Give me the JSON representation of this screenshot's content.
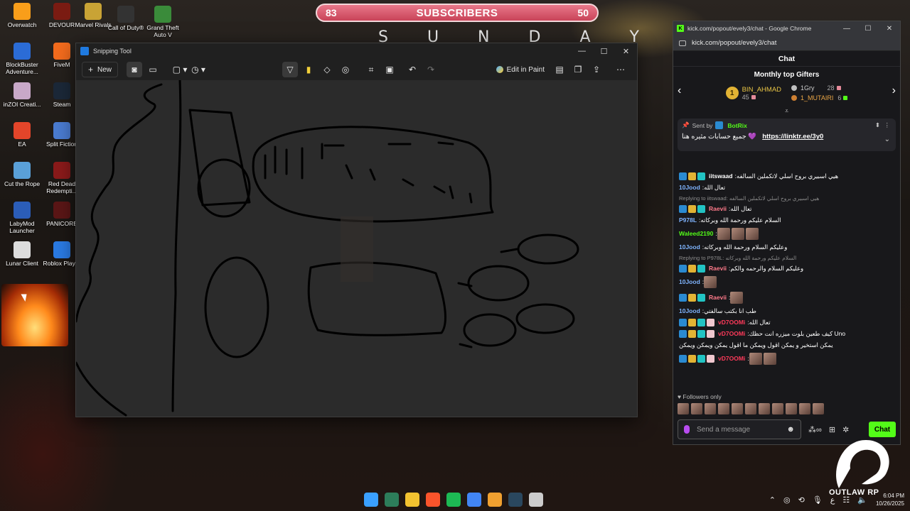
{
  "subscriber_bar": {
    "left_count": "83",
    "label": "SUBSCRIBERS",
    "right_count": "50"
  },
  "banner_text": "S U N D A Y",
  "desktop_icons": [
    {
      "label": "Overwatch",
      "color": "#f99e1a"
    },
    {
      "label": "DEVOUR",
      "color": "#7a1b12"
    },
    {
      "label": "Marvel Rivals",
      "color": "#c9a335"
    },
    {
      "label": "Call of Duty®",
      "color": "#333333"
    },
    {
      "label": "Grand Theft Auto V",
      "color": "#3a8b3a"
    },
    {
      "label": "BlockBuster Adventure...",
      "color": "#2b6cd6"
    },
    {
      "label": "FiveM",
      "color": "#f26b1d"
    },
    {
      "label": "inZOI Creati...",
      "color": "#c8a8c8"
    },
    {
      "label": "Steam",
      "color": "#1b2838"
    },
    {
      "label": "EA",
      "color": "#e3452a"
    },
    {
      "label": "Split Fiction",
      "color": "#4a7bd0"
    },
    {
      "label": "Cut the Rope",
      "color": "#5aa0d8"
    },
    {
      "label": "Red Dead Redempti...",
      "color": "#8a1a1a"
    },
    {
      "label": "LabyMod Launcher",
      "color": "#2b5db8"
    },
    {
      "label": "PANICORE",
      "color": "#5a1616"
    },
    {
      "label": "Lunar Client",
      "color": "#dddddd"
    },
    {
      "label": "Roblox Player",
      "color": "#2a7ae2"
    }
  ],
  "snipping_tool": {
    "title": "Snipping Tool",
    "new_label": "New",
    "edit_in_paint": "Edit in Paint",
    "window_controls": [
      "—",
      "☐",
      "✕"
    ]
  },
  "chat_window": {
    "chrome_title": "kick.com/popout/evely3/chat - Google Chrome",
    "url": "kick.com/popout/evely3/chat",
    "header": "Chat",
    "gifters_title": "Monthly top Gifters",
    "top_gifter": {
      "rank": "1",
      "name": "BIN_AHMAD",
      "count": "45"
    },
    "gifter_2": {
      "name": "1Gry",
      "count": "28"
    },
    "gifter_3": {
      "name": "1_MUTAIRI",
      "count": "6"
    },
    "pinned": {
      "sent_by": "Sent by",
      "bot": "BotRix",
      "message": "جميع حسابات مثيره هنا 💜",
      "link": "https://linktr.ee/3y0"
    },
    "messages": [
      {
        "user": "iitswaad",
        "user_color": "#ffffff",
        "badges": 3,
        "text": "هيي اسبيري بروح اسلي لاتكملين السالفه",
        "reply": ""
      },
      {
        "user": "10Jood",
        "user_color": "#7fb4ff",
        "badges": 0,
        "text": "تعال الله",
        "reply": ""
      },
      {
        "user": "Raevii",
        "user_color": "#ff7a8a",
        "badges": 3,
        "text": "تعال الله",
        "reply": "Replying to iitswaad: هيي اسبيري بروح اسلي لاتكملين السالفه"
      },
      {
        "user": "P978L",
        "user_color": "#7fb4ff",
        "badges": 0,
        "text": "السلام عليكم ورحمة الله وبركاته",
        "reply": ""
      },
      {
        "user": "Waleed2190",
        "user_color": "#53fc18",
        "badges": 0,
        "text": "",
        "emotes": 3,
        "reply": ""
      },
      {
        "user": "10Jood",
        "user_color": "#7fb4ff",
        "badges": 0,
        "text": "وعليكم السلام ورحمة الله وبركاته",
        "reply": ""
      },
      {
        "user": "Raevii",
        "user_color": "#ff7a8a",
        "badges": 3,
        "text": "وعليكم السلام والرحمه والكم",
        "reply": "Replying to P978L: السلام عليكم ورحمة الله وبركاته"
      },
      {
        "user": "10Jood",
        "user_color": "#7fb4ff",
        "badges": 0,
        "text": "",
        "emotes": 1,
        "reply": ""
      },
      {
        "user": "Raevii",
        "user_color": "#ff7a8a",
        "badges": 3,
        "text": "",
        "emotes": 1,
        "reply": ""
      },
      {
        "user": "10Jood",
        "user_color": "#7fb4ff",
        "badges": 0,
        "text": "طب انا بكتب سالفتي",
        "reply": ""
      },
      {
        "user": "vD7OOMi",
        "user_color": "#ff3a5a",
        "badges": 4,
        "text": "تعال الله",
        "reply": ""
      },
      {
        "user": "vD7OOMi",
        "user_color": "#ff3a5a",
        "badges": 4,
        "text": "كيف طعين بلوت ميزره انت حظك Uno",
        "reply": ""
      },
      {
        "user": "",
        "user_color": "#ffffff",
        "badges": 0,
        "text": "يمكن استخير و يمكن اقول ويمكن ما اقول يمكن ويمكن ويمكن",
        "reply": ""
      },
      {
        "user": "vD7OOMi",
        "user_color": "#ff3a5a",
        "badges": 4,
        "text": "",
        "emotes": 2,
        "reply": ""
      }
    ],
    "followers_only": "Followers only",
    "send_placeholder": "Send a message",
    "chat_button": "Chat"
  },
  "taskbar": {
    "icons": [
      "windows-start",
      "terminal",
      "file-explorer",
      "brave",
      "spotify",
      "chrome",
      "discord",
      "steam",
      "snipping-tool"
    ],
    "icon_colors": [
      "#3aa0ff",
      "#2d7d5a",
      "#f2c230",
      "#fb542b",
      "#1db954",
      "#4285f4",
      "#f0a030",
      "#2a475e",
      "#cccccc"
    ],
    "time": "6:04 PM",
    "date": "10/26/2025",
    "lang": "ع"
  },
  "overlay_logo_text": "OUTLAW RP"
}
